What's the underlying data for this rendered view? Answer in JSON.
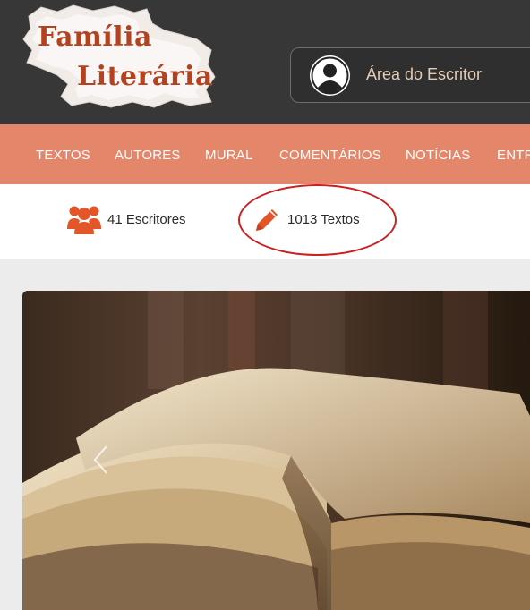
{
  "header": {
    "logo": {
      "line1": "Família",
      "line2": "Literária"
    },
    "writer_area": {
      "label": "Área do Escritor"
    }
  },
  "nav": {
    "items": [
      {
        "label": "TEXTOS"
      },
      {
        "label": "AUTORES"
      },
      {
        "label": "MURAL"
      },
      {
        "label": "COMENTÁRIOS"
      },
      {
        "label": "NOTÍCIAS"
      },
      {
        "label": "ENTR"
      }
    ]
  },
  "stats": {
    "writers": {
      "label": "41 Escritores",
      "icon": "users-icon"
    },
    "texts": {
      "label": "1013 Textos",
      "icon": "pencil-icon"
    }
  },
  "hero": {
    "image": "open-book-image",
    "control": "chevron-left-icon"
  },
  "colors": {
    "header_bg": "#373737",
    "nav_bg": "#e3866a",
    "accent": "#e2562a",
    "highlight_circle": "#cc1e1e",
    "logo_text": "#b5421f"
  }
}
